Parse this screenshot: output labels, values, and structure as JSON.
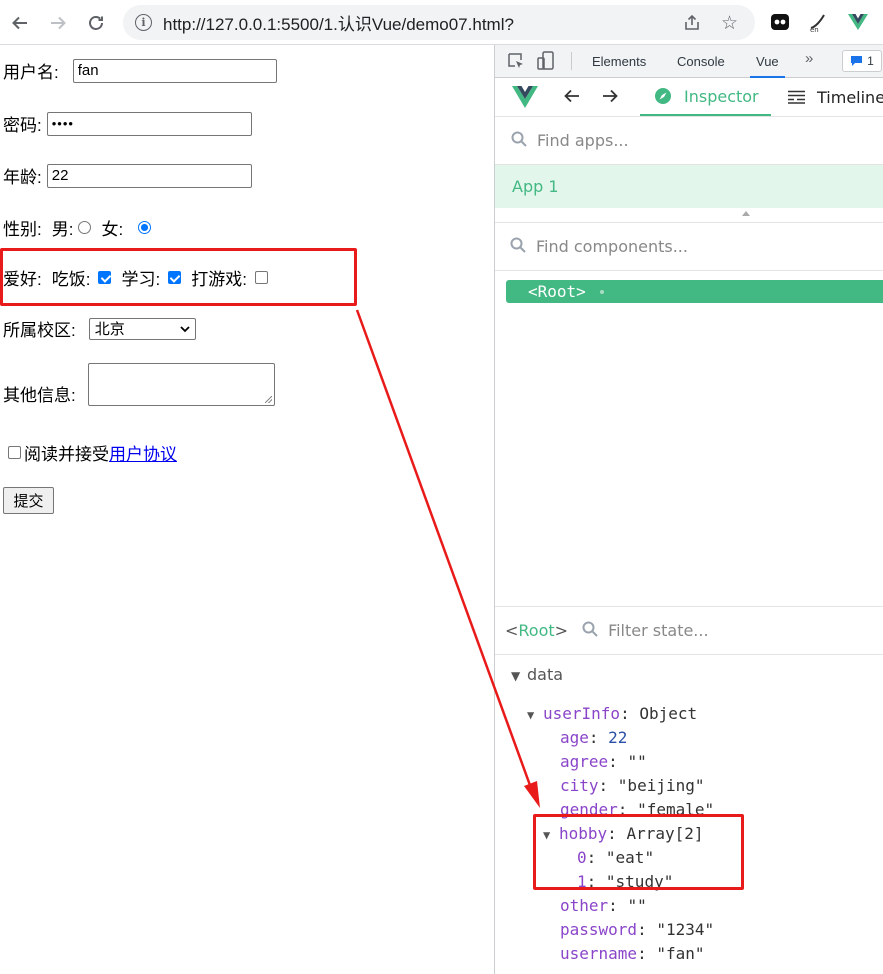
{
  "browser": {
    "url": "http://127.0.0.1:5500/1.认识Vue/demo07.html?",
    "back_icon": "arrow-left",
    "forward_icon": "arrow-right",
    "reload_icon": "reload"
  },
  "form": {
    "username_label": "用户名:",
    "username_value": "fan",
    "password_label": "密码:",
    "password_value": "••••",
    "age_label": "年龄:",
    "age_value": "22",
    "gender_label": "性别:",
    "male_label": "男:",
    "female_label": "女:",
    "hobby_label": "爱好:",
    "hobby_eat": "吃饭:",
    "hobby_study": "学习:",
    "hobby_game": "打游戏:",
    "campus_label": "所属校区:",
    "campus_value": "北京",
    "other_label": "其他信息:",
    "agree_text": "阅读并接受",
    "agree_link": "用户协议",
    "submit_label": "提交"
  },
  "devtools": {
    "tabs": [
      "Elements",
      "Console",
      "Vue"
    ],
    "badge_count": "1",
    "inspector_label": "Inspector",
    "timeline_label": "Timeline",
    "find_apps_placeholder": "Find apps...",
    "app_name": "App 1",
    "find_components_placeholder": "Find components...",
    "root_component": "<Root>",
    "root_name": "Root",
    "filter_placeholder": "Filter state...",
    "data_section": "data",
    "state": {
      "userInfo_key": "userInfo",
      "userInfo_type": "Object",
      "age_key": "age",
      "age_val": "22",
      "agree_key": "agree",
      "agree_val": "\"\"",
      "city_key": "city",
      "city_val": "\"beijing\"",
      "gender_key": "gender",
      "gender_val": "\"female\"",
      "hobby_key": "hobby",
      "hobby_type": "Array[2]",
      "hobby_0_key": "0",
      "hobby_0_val": "\"eat\"",
      "hobby_1_key": "1",
      "hobby_1_val": "\"study\"",
      "other_key": "other",
      "other_val": "\"\"",
      "password_key": "password",
      "password_val": "\"1234\"",
      "username_key": "username",
      "username_val": "\"fan\""
    }
  },
  "colors": {
    "vue_green": "#42b883",
    "annotation_red": "#e81a1a",
    "checkbox_blue": "#0075ff"
  }
}
